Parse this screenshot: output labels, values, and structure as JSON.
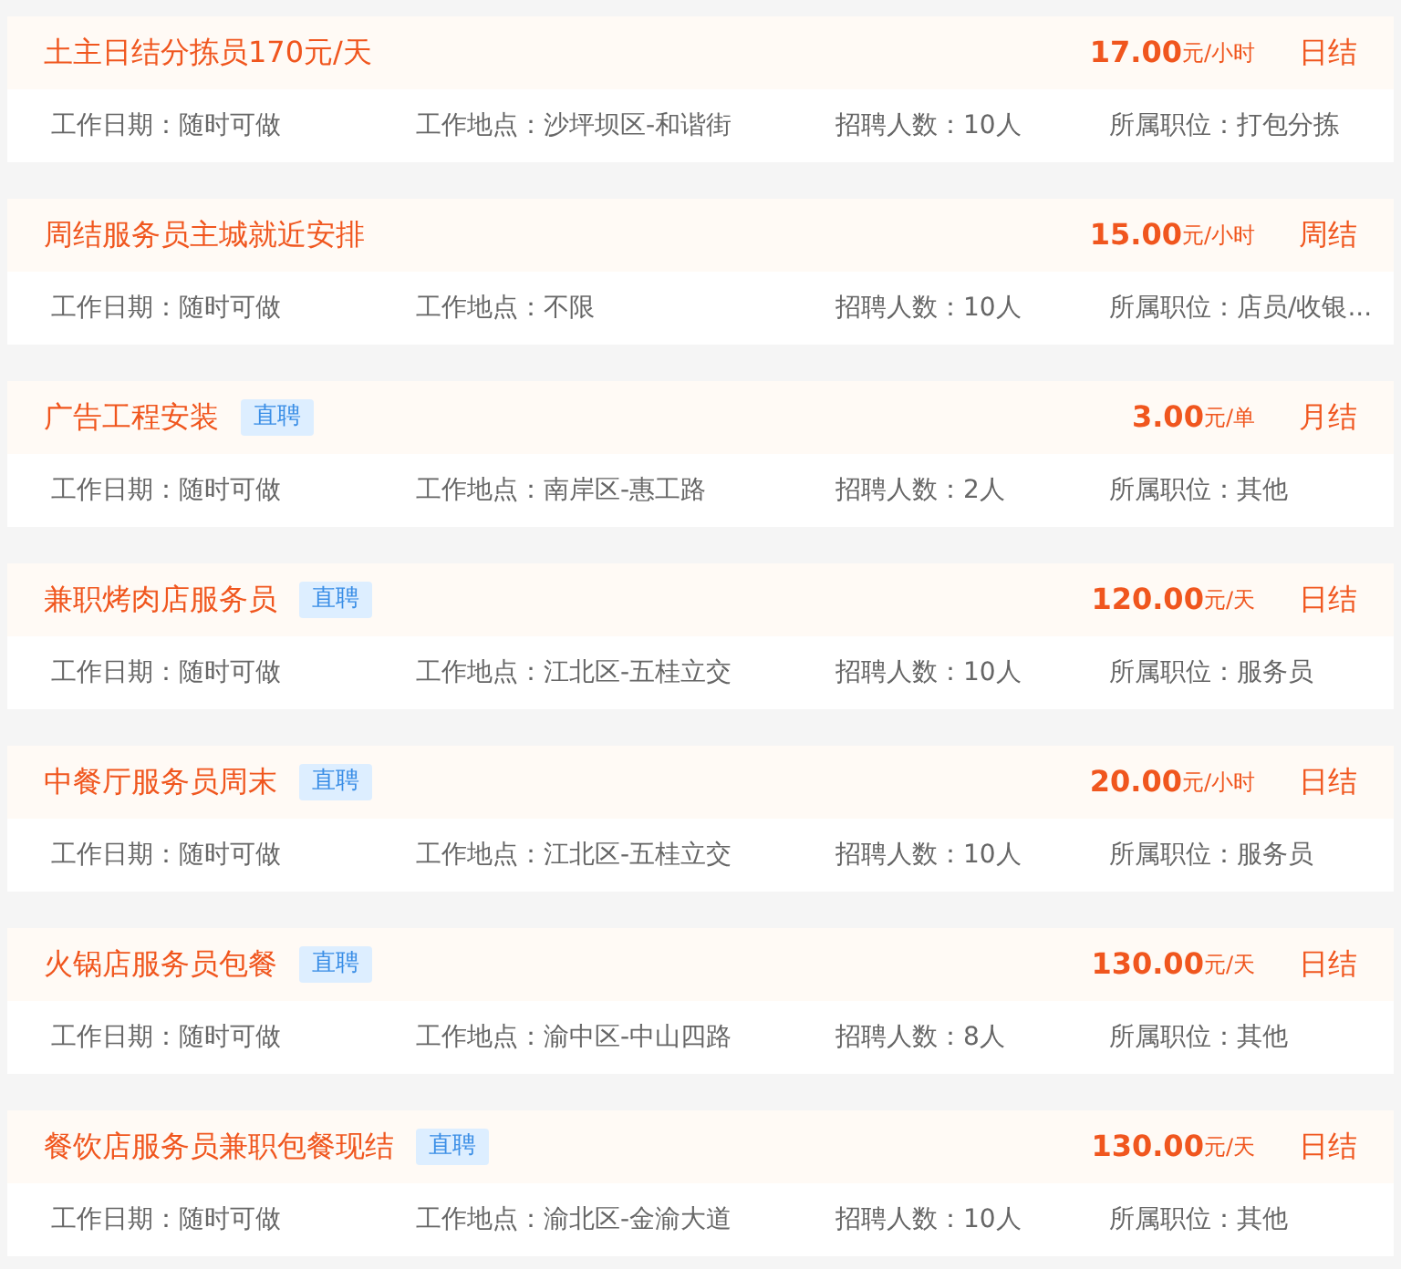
{
  "jobs": [
    {
      "title": "土主日结分拣员170元/天",
      "price": "17.00",
      "unit": "元/小时",
      "settlement": "日结",
      "fields": [
        {
          "label": "工作日期：",
          "value": "随时可做"
        },
        {
          "label": "工作地点：",
          "value": "沙坪坝区-和谐街"
        },
        {
          "label": "招聘人数：",
          "value": "10人"
        },
        {
          "label": "所属职位：",
          "value": "打包分拣"
        }
      ]
    },
    {
      "title": "周结服务员主城就近安排",
      "price": "15.00",
      "unit": "元/小时",
      "settlement": "周结",
      "fields": [
        {
          "label": "工作日期：",
          "value": "随时可做"
        },
        {
          "label": "工作地点：",
          "value": "不限"
        },
        {
          "label": "招聘人数：",
          "value": "10人"
        },
        {
          "label": "所属职位：",
          "value": "店员/收银..."
        }
      ]
    },
    {
      "title": "广告工程安装",
      "tag": "直聘",
      "price": "3.00",
      "unit": "元/单",
      "settlement": "月结",
      "fields": [
        {
          "label": "工作日期：",
          "value": "随时可做"
        },
        {
          "label": "工作地点：",
          "value": "南岸区-惠工路"
        },
        {
          "label": "招聘人数：",
          "value": "2人"
        },
        {
          "label": "所属职位：",
          "value": "其他"
        }
      ]
    },
    {
      "title": "兼职烤肉店服务员",
      "tag": "直聘",
      "price": "120.00",
      "unit": "元/天",
      "settlement": "日结",
      "fields": [
        {
          "label": "工作日期：",
          "value": "随时可做"
        },
        {
          "label": "工作地点：",
          "value": "江北区-五桂立交"
        },
        {
          "label": "招聘人数：",
          "value": "10人"
        },
        {
          "label": "所属职位：",
          "value": "服务员"
        }
      ]
    },
    {
      "title": "中餐厅服务员周末",
      "tag": "直聘",
      "price": "20.00",
      "unit": "元/小时",
      "settlement": "日结",
      "fields": [
        {
          "label": "工作日期：",
          "value": "随时可做"
        },
        {
          "label": "工作地点：",
          "value": "江北区-五桂立交"
        },
        {
          "label": "招聘人数：",
          "value": "10人"
        },
        {
          "label": "所属职位：",
          "value": "服务员"
        }
      ]
    },
    {
      "title": "火锅店服务员包餐",
      "tag": "直聘",
      "price": "130.00",
      "unit": "元/天",
      "settlement": "日结",
      "fields": [
        {
          "label": "工作日期：",
          "value": "随时可做"
        },
        {
          "label": "工作地点：",
          "value": "渝中区-中山四路"
        },
        {
          "label": "招聘人数：",
          "value": "8人"
        },
        {
          "label": "所属职位：",
          "value": "其他"
        }
      ]
    },
    {
      "title": "餐饮店服务员兼职包餐现结",
      "tag": "直聘",
      "price": "130.00",
      "unit": "元/天",
      "settlement": "日结",
      "fields": [
        {
          "label": "工作日期：",
          "value": "随时可做"
        },
        {
          "label": "工作地点：",
          "value": "渝北区-金渝大道"
        },
        {
          "label": "招聘人数：",
          "value": "10人"
        },
        {
          "label": "所属职位：",
          "value": "其他"
        }
      ]
    }
  ]
}
